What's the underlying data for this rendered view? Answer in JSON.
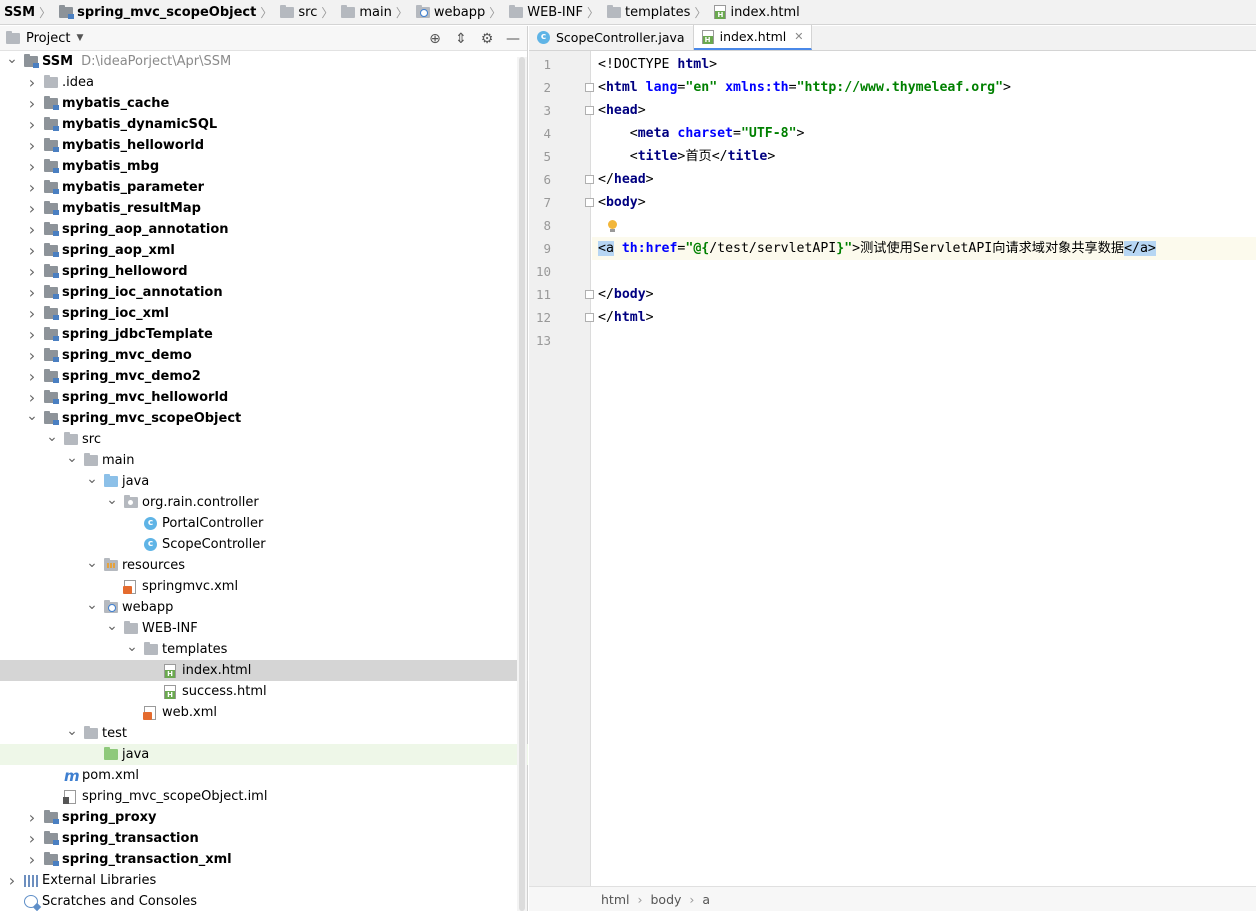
{
  "breadcrumb": [
    {
      "label": "SSM",
      "bold": true,
      "icon": "none"
    },
    {
      "label": "spring_mvc_scopeObject",
      "bold": true,
      "icon": "module-folder-icon"
    },
    {
      "label": "src",
      "bold": false,
      "icon": "folder-icon"
    },
    {
      "label": "main",
      "bold": false,
      "icon": "folder-icon"
    },
    {
      "label": "webapp",
      "bold": false,
      "icon": "web-folder-icon"
    },
    {
      "label": "WEB-INF",
      "bold": false,
      "icon": "folder-icon"
    },
    {
      "label": "templates",
      "bold": false,
      "icon": "folder-icon"
    },
    {
      "label": "index.html",
      "bold": false,
      "icon": "html-file-icon"
    }
  ],
  "project_panel": {
    "title": "Project",
    "tools": [
      "locate-icon",
      "collapse-all-icon",
      "gear-icon",
      "minimize-icon"
    ]
  },
  "tree": [
    {
      "label": "SSM",
      "path": "D:\\ideaPorject\\Apr\\SSM",
      "depth": 0,
      "arrow": "open",
      "icon": "module",
      "bold": true
    },
    {
      "label": ".idea",
      "depth": 1,
      "arrow": "closed",
      "icon": "folder"
    },
    {
      "label": "mybatis_cache",
      "depth": 1,
      "arrow": "closed",
      "icon": "module",
      "bold": true
    },
    {
      "label": "mybatis_dynamicSQL",
      "depth": 1,
      "arrow": "closed",
      "icon": "module",
      "bold": true
    },
    {
      "label": "mybatis_helloworld",
      "depth": 1,
      "arrow": "closed",
      "icon": "module",
      "bold": true
    },
    {
      "label": "mybatis_mbg",
      "depth": 1,
      "arrow": "closed",
      "icon": "module",
      "bold": true
    },
    {
      "label": "mybatis_parameter",
      "depth": 1,
      "arrow": "closed",
      "icon": "module",
      "bold": true
    },
    {
      "label": "mybatis_resultMap",
      "depth": 1,
      "arrow": "closed",
      "icon": "module",
      "bold": true
    },
    {
      "label": "spring_aop_annotation",
      "depth": 1,
      "arrow": "closed",
      "icon": "module",
      "bold": true
    },
    {
      "label": "spring_aop_xml",
      "depth": 1,
      "arrow": "closed",
      "icon": "module",
      "bold": true
    },
    {
      "label": "spring_helloword",
      "depth": 1,
      "arrow": "closed",
      "icon": "module",
      "bold": true
    },
    {
      "label": "spring_ioc_annotation",
      "depth": 1,
      "arrow": "closed",
      "icon": "module",
      "bold": true
    },
    {
      "label": "spring_ioc_xml",
      "depth": 1,
      "arrow": "closed",
      "icon": "module",
      "bold": true
    },
    {
      "label": "spring_jdbcTemplate",
      "depth": 1,
      "arrow": "closed",
      "icon": "module",
      "bold": true
    },
    {
      "label": "spring_mvc_demo",
      "depth": 1,
      "arrow": "closed",
      "icon": "module",
      "bold": true
    },
    {
      "label": "spring_mvc_demo2",
      "depth": 1,
      "arrow": "closed",
      "icon": "module",
      "bold": true
    },
    {
      "label": "spring_mvc_helloworld",
      "depth": 1,
      "arrow": "closed",
      "icon": "module",
      "bold": true
    },
    {
      "label": "spring_mvc_scopeObject",
      "depth": 1,
      "arrow": "open",
      "icon": "module",
      "bold": true
    },
    {
      "label": "src",
      "depth": 2,
      "arrow": "open",
      "icon": "folder"
    },
    {
      "label": "main",
      "depth": 3,
      "arrow": "open",
      "icon": "folder"
    },
    {
      "label": "java",
      "depth": 4,
      "arrow": "open",
      "icon": "folder-blue"
    },
    {
      "label": "org.rain.controller",
      "depth": 5,
      "arrow": "open",
      "icon": "package"
    },
    {
      "label": "PortalController",
      "depth": 6,
      "arrow": "none",
      "icon": "class"
    },
    {
      "label": "ScopeController",
      "depth": 6,
      "arrow": "none",
      "icon": "class"
    },
    {
      "label": "resources",
      "depth": 4,
      "arrow": "open",
      "icon": "folder-res"
    },
    {
      "label": "springmvc.xml",
      "depth": 5,
      "arrow": "none",
      "icon": "xml"
    },
    {
      "label": "webapp",
      "depth": 4,
      "arrow": "open",
      "icon": "folder-web"
    },
    {
      "label": "WEB-INF",
      "depth": 5,
      "arrow": "open",
      "icon": "folder"
    },
    {
      "label": "templates",
      "depth": 6,
      "arrow": "open",
      "icon": "folder"
    },
    {
      "label": "index.html",
      "depth": 7,
      "arrow": "none",
      "icon": "html",
      "selected": true
    },
    {
      "label": "success.html",
      "depth": 7,
      "arrow": "none",
      "icon": "html"
    },
    {
      "label": "web.xml",
      "depth": 6,
      "arrow": "none",
      "icon": "xml"
    },
    {
      "label": "test",
      "depth": 3,
      "arrow": "open",
      "icon": "folder"
    },
    {
      "label": "java",
      "depth": 4,
      "arrow": "none",
      "icon": "folder-green",
      "highlight": true
    },
    {
      "label": "pom.xml",
      "depth": 2,
      "arrow": "none",
      "icon": "pom"
    },
    {
      "label": "spring_mvc_scopeObject.iml",
      "depth": 2,
      "arrow": "none",
      "icon": "iml"
    },
    {
      "label": "spring_proxy",
      "depth": 1,
      "arrow": "closed",
      "icon": "module",
      "bold": true
    },
    {
      "label": "spring_transaction",
      "depth": 1,
      "arrow": "closed",
      "icon": "module",
      "bold": true
    },
    {
      "label": "spring_transaction_xml",
      "depth": 1,
      "arrow": "closed",
      "icon": "module",
      "bold": true
    },
    {
      "label": "External Libraries",
      "depth": 0,
      "arrow": "closed",
      "icon": "lib"
    },
    {
      "label": "Scratches and Consoles",
      "depth": 0,
      "arrow": "none",
      "icon": "scratch"
    }
  ],
  "tabs": [
    {
      "label": "ScopeController.java",
      "icon": "class",
      "active": false
    },
    {
      "label": "index.html",
      "icon": "html",
      "active": true
    }
  ],
  "editor": {
    "current_line": 9,
    "lines": [
      {
        "no": "1",
        "parts": [
          [
            "txtc",
            "<!DOCTYPE "
          ],
          [
            "tag",
            "html"
          ],
          [
            "txtc",
            ">"
          ]
        ]
      },
      {
        "no": "2",
        "fold": true,
        "parts": [
          [
            "txtc",
            "<"
          ],
          [
            "tag",
            "html "
          ],
          [
            "attr",
            "lang"
          ],
          [
            "txtc",
            "="
          ],
          [
            "str",
            "\"en\""
          ],
          [
            "txtc",
            " "
          ],
          [
            "attr",
            "xmlns:th"
          ],
          [
            "txtc",
            "="
          ],
          [
            "str",
            "\"http://www.thymeleaf.org\""
          ],
          [
            "txtc",
            ">"
          ]
        ]
      },
      {
        "no": "3",
        "fold": true,
        "parts": [
          [
            "txtc",
            "<"
          ],
          [
            "tag",
            "head"
          ],
          [
            "txtc",
            ">"
          ]
        ]
      },
      {
        "no": "4",
        "parts": [
          [
            "txtc",
            "    <"
          ],
          [
            "tag",
            "meta "
          ],
          [
            "attr",
            "charset"
          ],
          [
            "txtc",
            "="
          ],
          [
            "str",
            "\"UTF-8\""
          ],
          [
            "txtc",
            ">"
          ]
        ]
      },
      {
        "no": "5",
        "parts": [
          [
            "txtc",
            "    <"
          ],
          [
            "tag",
            "title"
          ],
          [
            "txtc",
            ">首页</"
          ],
          [
            "tag",
            "title"
          ],
          [
            "txtc",
            ">"
          ]
        ]
      },
      {
        "no": "6",
        "fold": true,
        "parts": [
          [
            "txtc",
            "</"
          ],
          [
            "tag",
            "head"
          ],
          [
            "txtc",
            ">"
          ]
        ]
      },
      {
        "no": "7",
        "fold": true,
        "parts": [
          [
            "txtc",
            "<"
          ],
          [
            "tag",
            "body"
          ],
          [
            "txtc",
            ">"
          ]
        ]
      },
      {
        "no": "8",
        "parts": []
      },
      {
        "no": "9",
        "parts": [
          [
            "hl",
            "<a"
          ],
          [
            "txtc",
            " "
          ],
          [
            "attr",
            "th:href"
          ],
          [
            "txtc",
            "="
          ],
          [
            "str",
            "\"@{"
          ],
          [
            "txtc",
            "/test/servletAPI"
          ],
          [
            "str",
            "}\""
          ],
          [
            "txtc",
            ">测试使用ServletAPI向请求域对象共享数据"
          ],
          [
            "hl",
            "</a>"
          ]
        ]
      },
      {
        "no": "10",
        "parts": []
      },
      {
        "no": "11",
        "fold": true,
        "parts": [
          [
            "txtc",
            "</"
          ],
          [
            "tag",
            "body"
          ],
          [
            "txtc",
            ">"
          ]
        ]
      },
      {
        "no": "12",
        "fold": true,
        "parts": [
          [
            "txtc",
            "</"
          ],
          [
            "tag",
            "html"
          ],
          [
            "txtc",
            ">"
          ]
        ]
      },
      {
        "no": "13",
        "parts": []
      }
    ]
  },
  "status_breadcrumb": [
    "html",
    "body",
    "a"
  ]
}
